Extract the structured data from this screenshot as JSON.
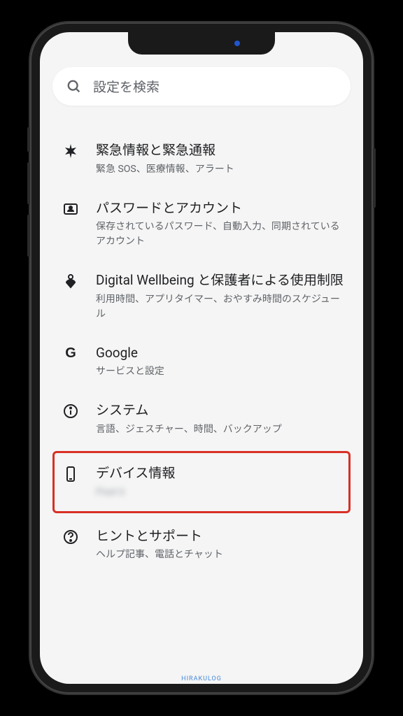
{
  "search": {
    "placeholder": "設定を検索"
  },
  "items": [
    {
      "title": "緊急情報と緊急通報",
      "subtitle": "緊急 SOS、医療情報、アラート",
      "icon": "asterisk"
    },
    {
      "title": "パスワードとアカウント",
      "subtitle": "保存されているパスワード、自動入力、同期されているアカウント",
      "icon": "account"
    },
    {
      "title": "Digital Wellbeing と保護者による使用制限",
      "subtitle": "利用時間、アプリタイマー、おやすみ時間のスケジュール",
      "icon": "wellbeing"
    },
    {
      "title": "Google",
      "subtitle": "サービスと設定",
      "icon": "google"
    },
    {
      "title": "システム",
      "subtitle": "言語、ジェスチャー、時間、バックアップ",
      "icon": "info"
    },
    {
      "title": "デバイス情報",
      "subtitle": "Pixel 6",
      "icon": "phone",
      "highlighted": true,
      "blurred": true
    },
    {
      "title": "ヒントとサポート",
      "subtitle": "ヘルプ記事、電話とチャット",
      "icon": "help"
    }
  ],
  "watermark": "HIRAKULOG"
}
